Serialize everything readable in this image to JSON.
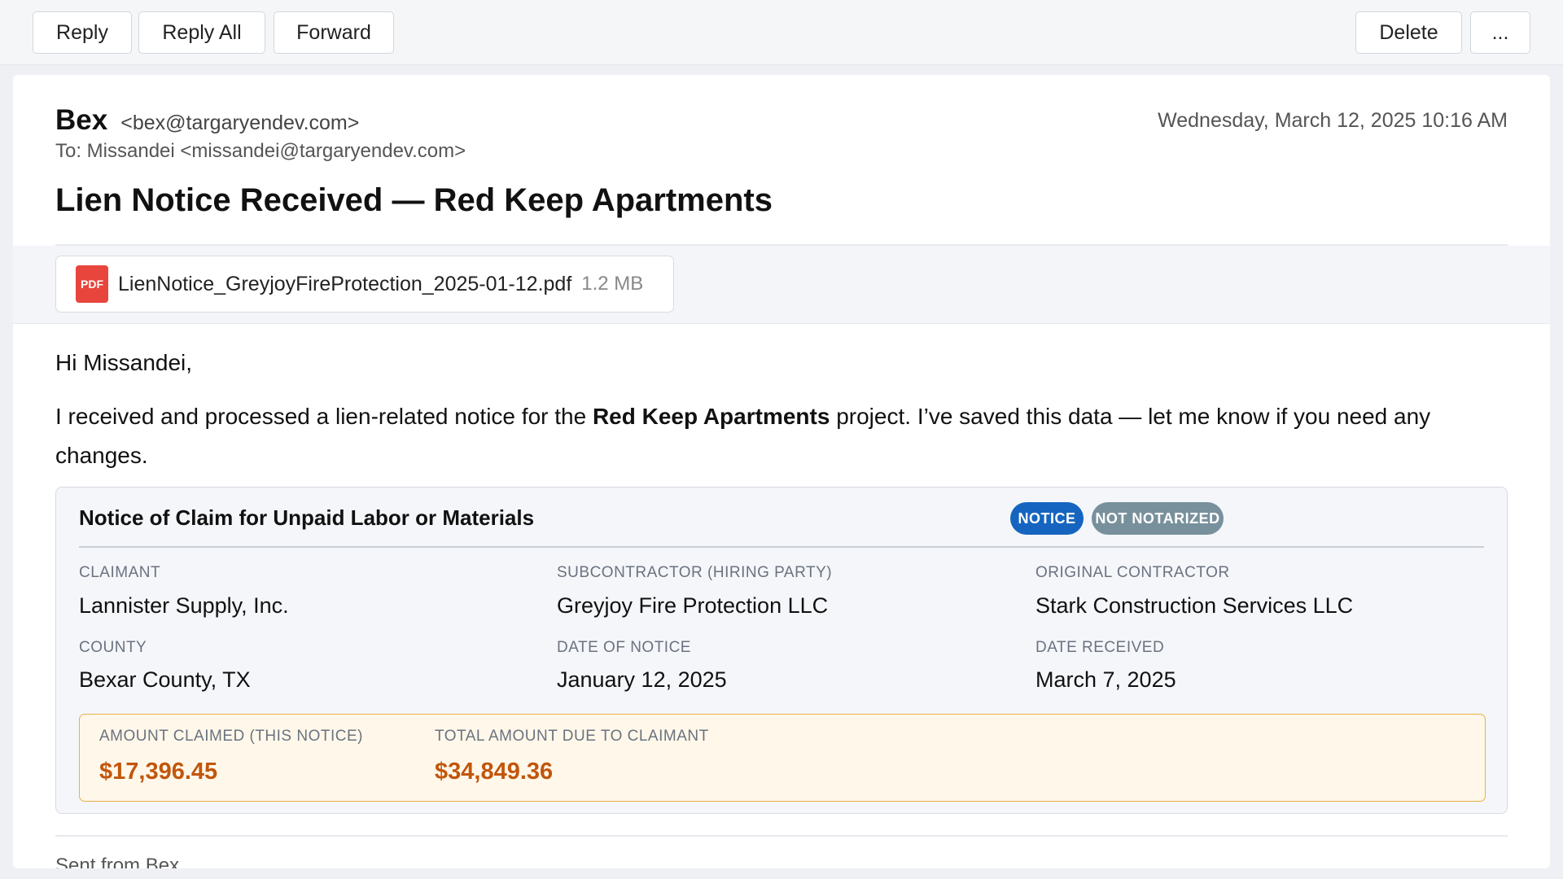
{
  "toolbar": {
    "reply": "Reply",
    "reply_all": "Reply All",
    "forward": "Forward",
    "delete": "Delete",
    "more": "..."
  },
  "email": {
    "sender_name": "Bex",
    "sender_email": "<bex@targaryendev.com>",
    "date": "Wednesday, March 12, 2025 10:16 AM",
    "to": "To: Missandei <missandei@targaryendev.com>",
    "subject": "Lien Notice Received — Red Keep Apartments",
    "attachment": {
      "icon": "PDF",
      "filename": "LienNotice_GreyjoyFireProtection_2025-01-12.pdf",
      "size": "1.2 MB"
    },
    "greeting": "Hi Missandei,",
    "body_pre": "I received and processed a lien-related notice for the ",
    "body_bold": "Red Keep Apartments",
    "body_post": " project. I’ve saved this data — let me know if you need any changes.",
    "signature": "Sent from Bex"
  },
  "notice": {
    "title": "Notice of Claim for Unpaid Labor or Materials",
    "badge_notice": "NOTICE",
    "badge_notarized": "NOT NOTARIZED",
    "claimant_label": "CLAIMANT",
    "claimant_value": "Lannister Supply, Inc.",
    "sub_label": "SUBCONTRACTOR (HIRING PARTY)",
    "sub_value": "Greyjoy Fire Protection LLC",
    "orig_label": "ORIGINAL CONTRACTOR",
    "orig_value": "Stark Construction Services LLC",
    "county_label": "COUNTY",
    "county_value": "Bexar County, TX",
    "date_notice_label": "DATE OF NOTICE",
    "date_notice_value": "January 12, 2025",
    "date_received_label": "DATE RECEIVED",
    "date_received_value": "March 7, 2025",
    "amount_claimed_label": "AMOUNT CLAIMED (THIS NOTICE)",
    "amount_claimed_value": "$17,396.45",
    "total_due_label": "TOTAL AMOUNT DUE TO CLAIMANT",
    "total_due_value": "$34,849.36"
  },
  "colors": {
    "badge_notice": "#1565c0",
    "badge_notarized": "#78909c",
    "amount": "#c2560c",
    "pdf_icon": "#e8453c"
  }
}
